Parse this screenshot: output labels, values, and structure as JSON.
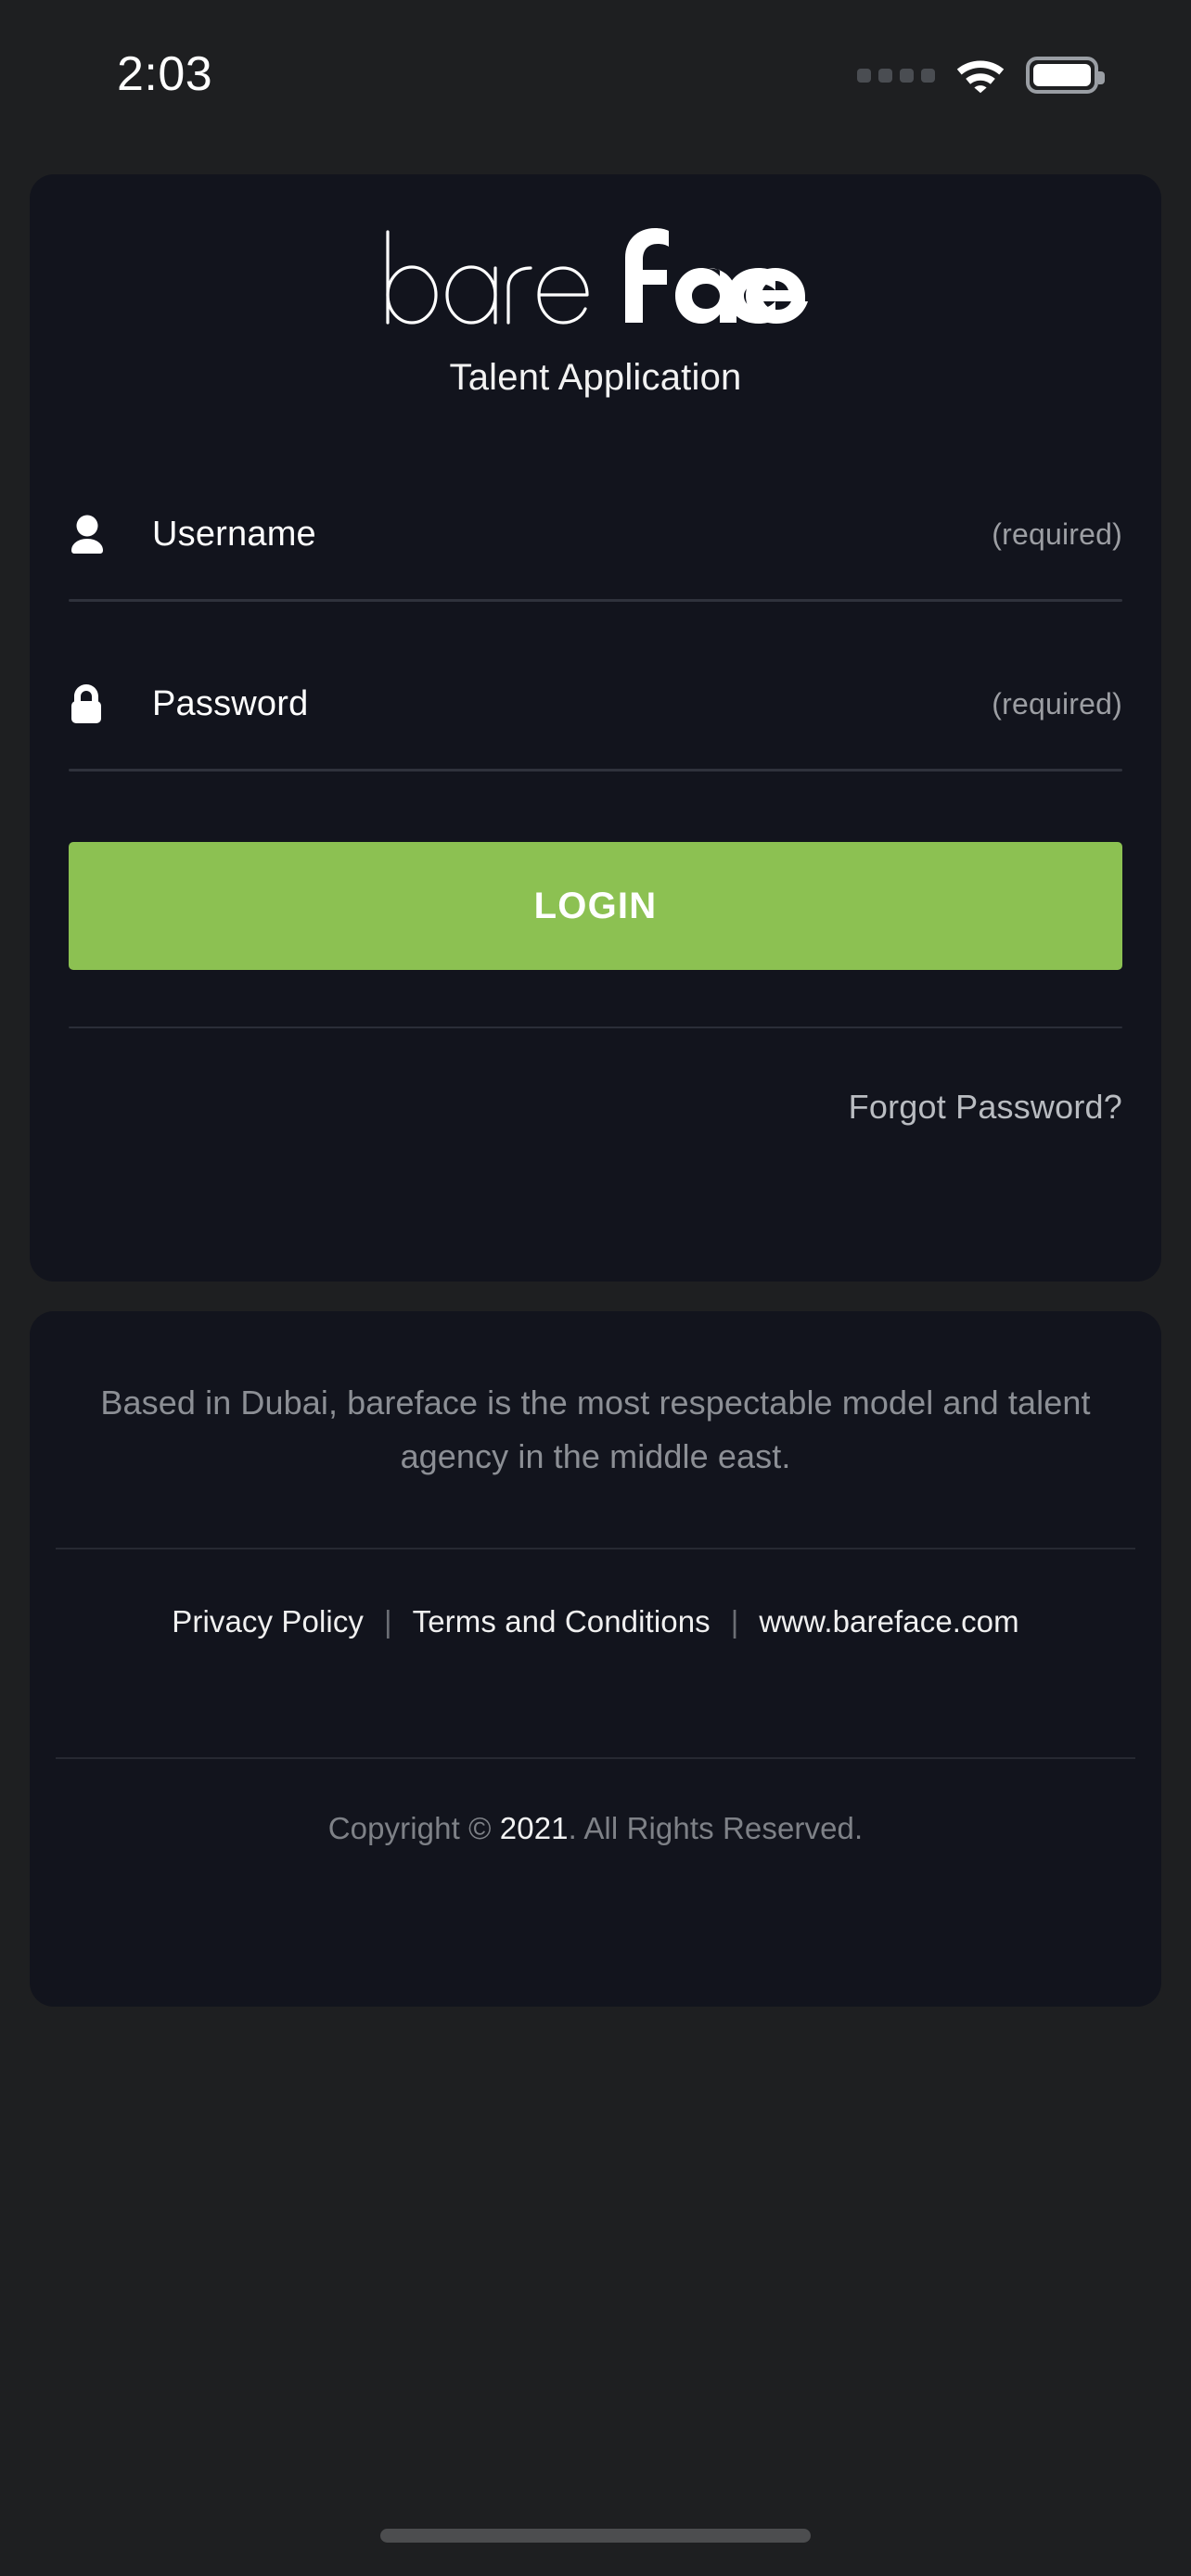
{
  "status_bar": {
    "time": "2:03",
    "signal_icon": "signal-dots-icon",
    "wifi_icon": "wifi-icon",
    "battery_icon": "battery-full-icon"
  },
  "brand": {
    "logo_text_light": "bare",
    "logo_text_bold": "face",
    "logo_full": "bareface",
    "subtitle": "Talent Application"
  },
  "form": {
    "username": {
      "icon": "person-icon",
      "label": "Username",
      "placeholder": "Username",
      "value": "",
      "required_hint": "(required)"
    },
    "password": {
      "icon": "lock-icon",
      "label": "Password",
      "placeholder": "Password",
      "value": "",
      "required_hint": "(required)"
    },
    "login_button": "LOGIN",
    "forgot_password": "Forgot Password?"
  },
  "footer": {
    "blurb": "Based in Dubai, bareface is the most respectable model and talent agency in the middle east.",
    "links": [
      {
        "label": "Privacy Policy"
      },
      {
        "label": "Terms and Conditions"
      },
      {
        "label": "www.bareface.com"
      }
    ],
    "separator": "|",
    "copyright_prefix": "Copyright © ",
    "copyright_year": "2021",
    "copyright_suffix": ". All Rights Reserved."
  },
  "colors": {
    "page_background": "#1e1f21",
    "card_background": "#12141d",
    "accent_green": "#8cc152",
    "text_primary": "#ffffff",
    "text_muted": "#8c8f95",
    "divider": "#2b2e38",
    "home_indicator": "#4c4d4f"
  }
}
